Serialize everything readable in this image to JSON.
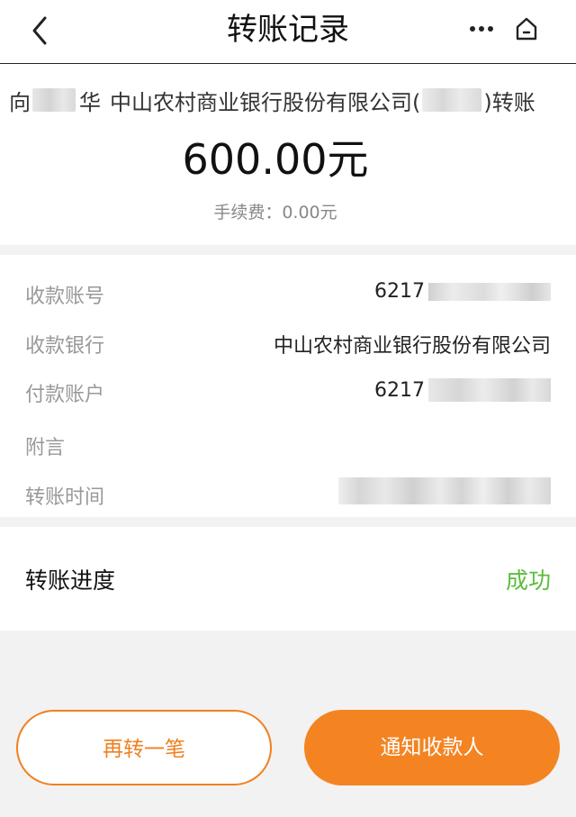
{
  "header": {
    "title": "转账记录",
    "icons": [
      "back-chevron-icon",
      "more-dots-icon",
      "home-icon"
    ]
  },
  "summary": {
    "prefix": "向",
    "name_suffix": "华",
    "bank_name": "中山农村商业银行股份有限公司(",
    "suffix": ")转账",
    "amount": "600.00元",
    "fee": "手续费：0.00元"
  },
  "details": {
    "payee_account_label": "收款账号",
    "payee_account_value": "6217",
    "payee_bank_label": "收款银行",
    "payee_bank_value": "中山农村商业银行股份有限公司",
    "payer_account_label": "付款账户",
    "payer_account_value": "6217",
    "memo_label": "附言",
    "memo_value": "",
    "time_label": "转账时间"
  },
  "progress": {
    "label": "转账进度",
    "status": "成功",
    "status_color": "#5bbd3c"
  },
  "actions": {
    "again": "再转一笔",
    "notify": "通知收款人",
    "accent_color": "#f38421"
  }
}
